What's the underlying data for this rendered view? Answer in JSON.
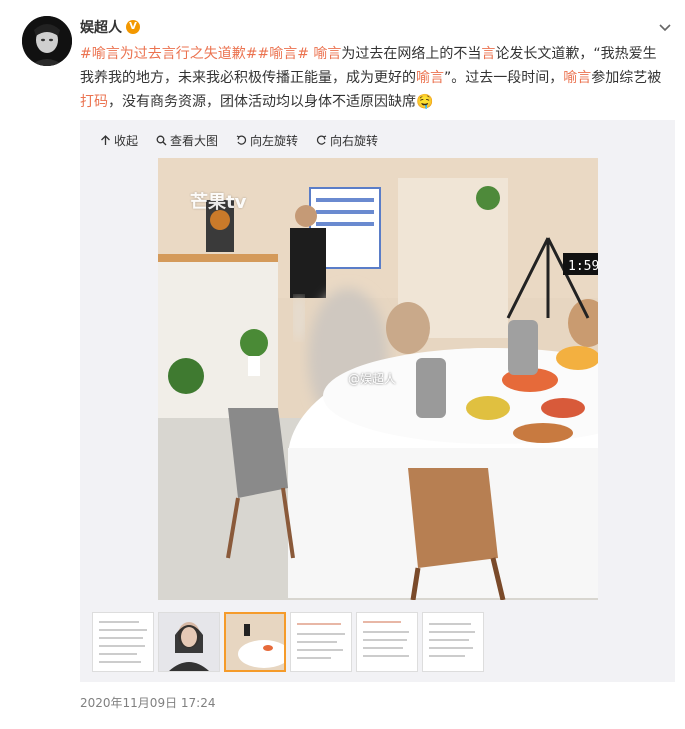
{
  "user": {
    "name": "娱超人",
    "verified_badge": "V"
  },
  "post": {
    "tag1": "#喻言为过去言行之失道歉#",
    "tag2": "#喻言#",
    "t1": " 喻言",
    "t2": "为过去在网络上的不当",
    "t3": "言",
    "t4": "论发长文道歉，“我热爱生我养我的地方，未来我必积极传播正能量，成为更好的",
    "t5": "喻言",
    "t6": "”。过去一段时间，",
    "t7": "喻言",
    "t8": "参加综艺被",
    "t9": "打码",
    "t10": "，没有商务资源，团体活动均以身体不适原因缺席",
    "emoji": "🤤"
  },
  "toolbar": {
    "collapse": "收起",
    "view_large": "查看大图",
    "rotate_left": "向左旋转",
    "rotate_right": "向右旋转"
  },
  "image": {
    "watermark": "@娱超人",
    "logo": "芒果tv",
    "clock": "1:59"
  },
  "timestamp": "2020年11月09日 17:24",
  "colors": {
    "link": "#eb7350",
    "hashtag": "#5a8cd9",
    "active_thumb": "#f59b2a"
  },
  "icons": [
    "more-chevron-icon",
    "collapse-arrow-icon",
    "magnifier-icon",
    "rotate-left-icon",
    "rotate-right-icon"
  ]
}
